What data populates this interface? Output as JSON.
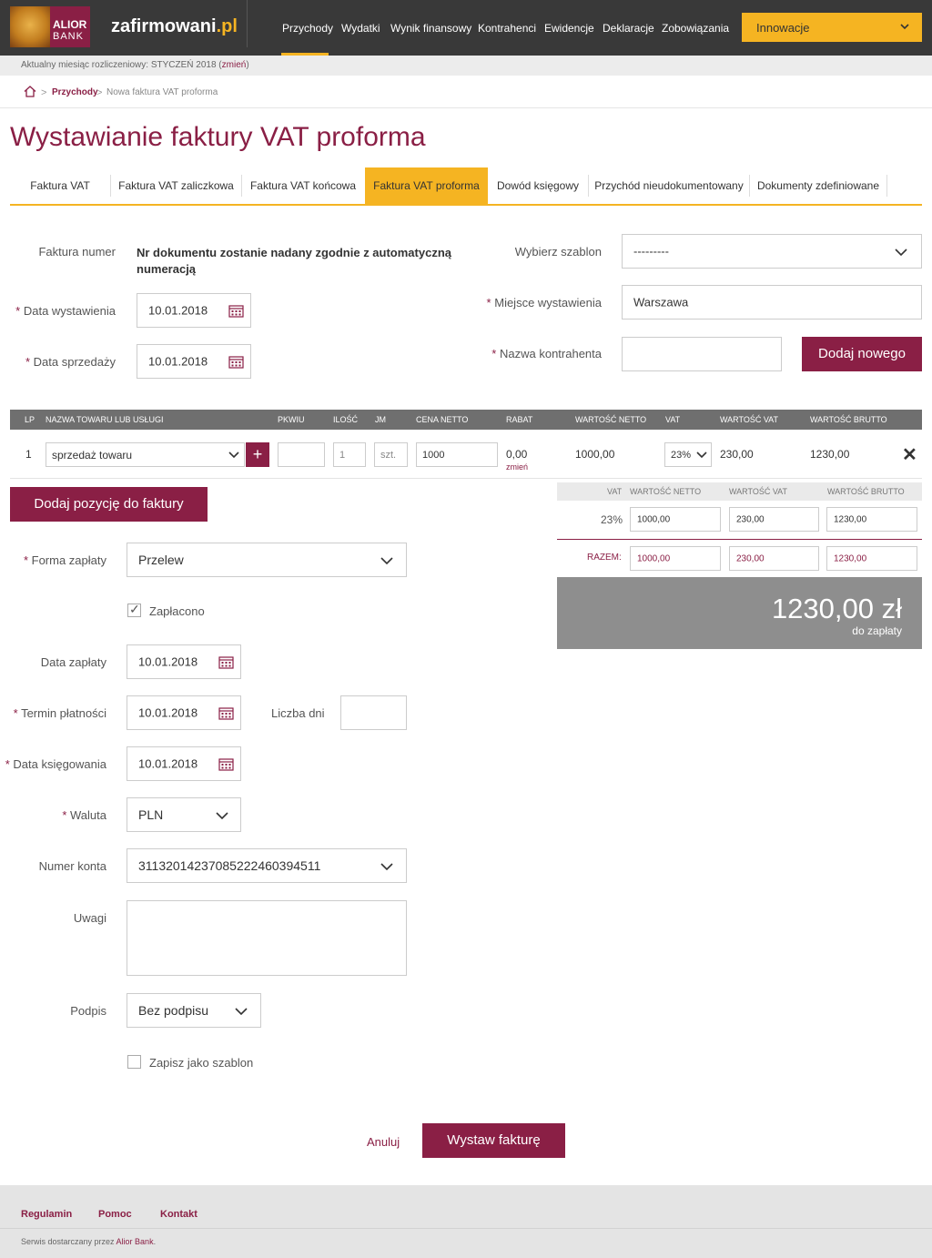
{
  "brand": {
    "bank_line1": "ALIOR",
    "bank_line2": "BANK",
    "name_main": "zafirmowani",
    "name_tld": ".pl"
  },
  "nav": {
    "items": [
      "Przychody",
      "Wydatki",
      "Wynik finansowy",
      "Kontrahenci",
      "Ewidencje",
      "Deklaracje",
      "Zobowiązania"
    ],
    "dropdown_label": "Innowacje"
  },
  "month": {
    "text": "Aktualny miesiąc rozliczeniowy: STYCZEŃ 2018 (",
    "link": "zmień",
    "close": ")"
  },
  "breadcrumb": {
    "sep": ">",
    "items": [
      "Przychody",
      "Nowa faktura VAT proforma"
    ]
  },
  "page": {
    "title": "Wystawianie faktury VAT proforma"
  },
  "tabs": [
    "Faktura VAT",
    "Faktura VAT zaliczkowa",
    "Faktura VAT końcowa",
    "Faktura VAT proforma",
    "Dowód księgowy",
    "Przychód nieudokumentowany",
    "Dokumenty zdefiniowane"
  ],
  "req_mark": "*",
  "form": {
    "invoice_number_label": "Faktura numer",
    "invoice_number_text_1": "Nr dokumentu zostanie nadany zgodnie z automatyczną",
    "invoice_number_text_2": "numeracją",
    "issue_date_label": "Data wystawienia",
    "issue_date_value": "10.01.2018",
    "sale_date_label": "Data sprzedaży",
    "sale_date_value": "10.01.2018",
    "template_label": "Wybierz szablon",
    "template_value": "---------",
    "place_label": "Miejsce wystawienia",
    "place_value": "Warszawa",
    "contractor_label": "Nazwa kontrahenta",
    "contractor_value": "",
    "add_new_button": "Dodaj nowego"
  },
  "items_table": {
    "headers": [
      "LP",
      "NAZWA TOWARU LUB USŁUGI",
      "PKWIU",
      "ILOŚĆ",
      "JM",
      "CENA NETTO",
      "RABAT",
      "WARTOŚĆ NETTO",
      "VAT",
      "WARTOŚĆ VAT",
      "WARTOŚĆ BRUTTO"
    ],
    "rows": [
      {
        "lp": "1",
        "name": "sprzedaż towaru",
        "add": "+",
        "pkwiu": "",
        "qty": "1",
        "unit": "szt.",
        "net_price": "1000",
        "discount": "0,00",
        "discount_link": "zmień",
        "net_value": "1000,00",
        "vat": "23%",
        "vat_value": "230,00",
        "gross_value": "1230,00",
        "remove": "✕"
      }
    ]
  },
  "add_item_button": "Dodaj pozycję do faktury",
  "summary": {
    "headers": [
      "VAT",
      "WARTOŚĆ NETTO",
      "WARTOŚĆ VAT",
      "WARTOŚĆ BRUTTO"
    ],
    "rate": "23%",
    "net": "1000,00",
    "vat": "230,00",
    "gross": "1230,00",
    "total_label": "RAZEM:",
    "total_net": "1000,00",
    "total_vat": "230,00",
    "total_gross": "1230,00",
    "amount_due": "1230,00 zł",
    "amount_due_label": "do zapłaty"
  },
  "payment": {
    "method_label": "Forma zapłaty",
    "method_value": "Przelew",
    "paid_label": "Zapłacono",
    "paid_check": "✓",
    "pay_date_label": "Data zapłaty",
    "pay_date_value": "10.01.2018",
    "due_date_label": "Termin płatności",
    "due_date_value": "10.01.2018",
    "days_label": "Liczba dni",
    "days_value": "",
    "booking_date_label": "Data księgowania",
    "booking_date_value": "10.01.2018",
    "currency_label": "Waluta",
    "currency_value": "PLN",
    "account_label": "Numer konta",
    "account_value": "31132014237085222460394511",
    "notes_label": "Uwagi",
    "notes_value": "",
    "signature_label": "Podpis",
    "signature_value": "Bez podpisu",
    "save_template_label": "Zapisz jako szablon"
  },
  "actions": {
    "cancel": "Anuluj",
    "submit": "Wystaw fakturę"
  },
  "footer": {
    "links": [
      "Regulamin",
      "Pomoc",
      "Kontakt"
    ],
    "copy_text": "Serwis dostarczany przez ",
    "copy_link": "Alior Bank",
    "copy_end": "."
  }
}
